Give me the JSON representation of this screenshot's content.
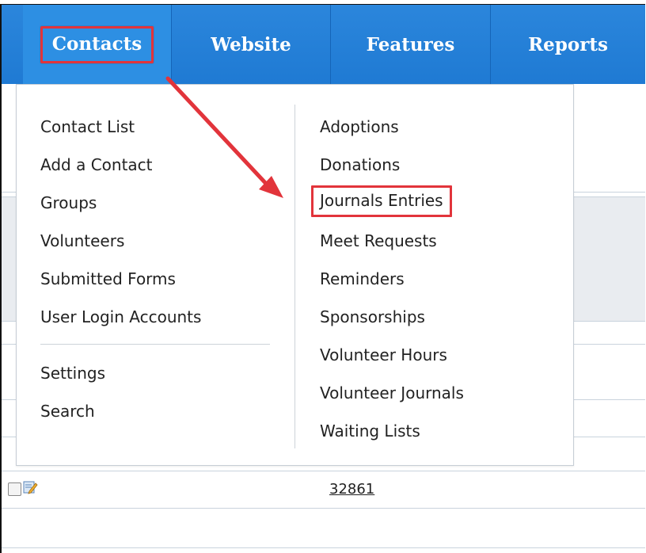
{
  "nav": {
    "items": [
      {
        "label": "Contacts"
      },
      {
        "label": "Website"
      },
      {
        "label": "Features"
      },
      {
        "label": "Reports"
      }
    ]
  },
  "dropdown": {
    "left_items": [
      {
        "label": "Contact List"
      },
      {
        "label": "Add a Contact"
      },
      {
        "label": "Groups"
      },
      {
        "label": "Volunteers"
      },
      {
        "label": "Submitted Forms"
      },
      {
        "label": "User Login Accounts"
      }
    ],
    "left_items_bottom": [
      {
        "label": "Settings"
      },
      {
        "label": "Search"
      }
    ],
    "right_items": [
      {
        "label": "Adoptions"
      },
      {
        "label": "Donations"
      },
      {
        "label": "Journals Entries"
      },
      {
        "label": "Meet Requests"
      },
      {
        "label": "Reminders"
      },
      {
        "label": "Sponsorships"
      },
      {
        "label": "Volunteer Hours"
      },
      {
        "label": "Volunteer Journals"
      },
      {
        "label": "Waiting Lists"
      }
    ]
  },
  "table": {
    "row_id": "32861"
  },
  "colors": {
    "nav_bg": "#1f7ad3",
    "highlight_border": "#e2343b",
    "arrow": "#e2343b"
  }
}
